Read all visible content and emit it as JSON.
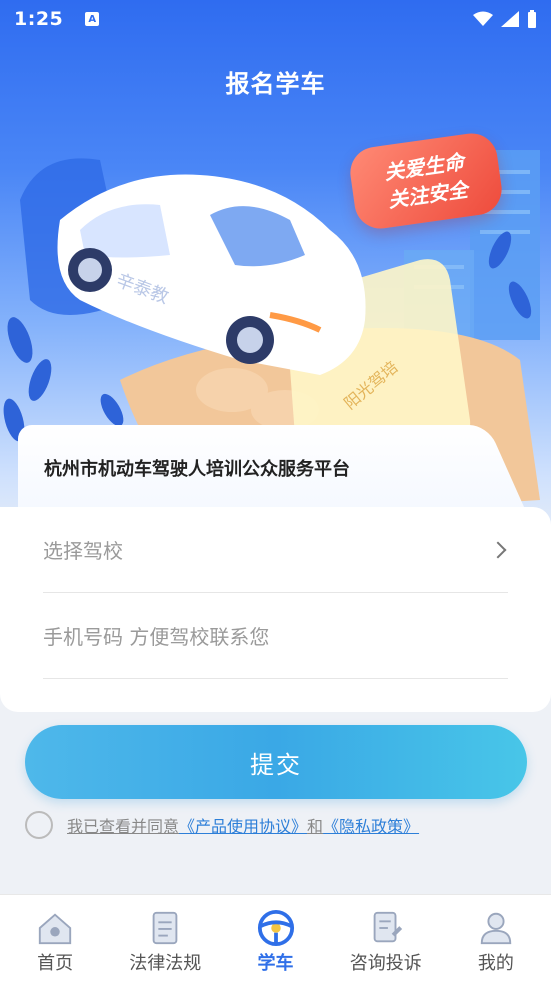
{
  "status": {
    "time": "1:25",
    "notif": "A"
  },
  "header": {
    "title": "报名学车"
  },
  "banner": {
    "slogan_line1": "关爱生命",
    "slogan_line2": "关注安全",
    "car_text": "辛泰教",
    "phone_text": "阳光驾培"
  },
  "form": {
    "platform_name": "杭州市机动车驾驶人培训公众服务平台",
    "school_placeholder": "选择驾校",
    "phone_placeholder": "手机号码 方便驾校联系您"
  },
  "submit": {
    "label": "提交"
  },
  "agreement": {
    "prefix": "我已查看并同意",
    "product_agreement": "《产品使用协议》",
    "and": "和",
    "privacy_policy": "《隐私政策》"
  },
  "tabs": [
    {
      "label": "首页",
      "icon": "home-icon"
    },
    {
      "label": "法律法规",
      "icon": "law-book-icon"
    },
    {
      "label": "学车",
      "icon": "steering-wheel-icon",
      "active": true
    },
    {
      "label": "咨询投诉",
      "icon": "complaint-doc-icon"
    },
    {
      "label": "我的",
      "icon": "user-icon"
    }
  ],
  "colors": {
    "primary": "#2f6fe8",
    "button": "#3aa8e6",
    "slogan": "#ee4b3c"
  }
}
